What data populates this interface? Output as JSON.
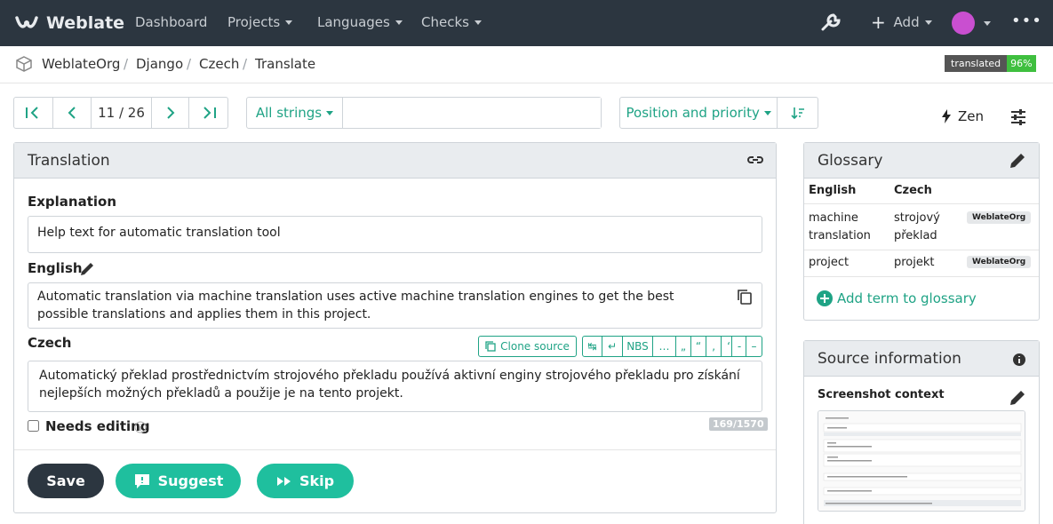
{
  "navbar": {
    "brand": "Weblate",
    "links": {
      "dashboard": "Dashboard",
      "projects": "Projects",
      "languages": "Languages",
      "checks": "Checks"
    },
    "add_label": "Add"
  },
  "breadcrumb": {
    "items": [
      "WeblateOrg",
      "Django",
      "Czech",
      "Translate"
    ],
    "separator": "/",
    "badge_label": "translated",
    "badge_value": "96%"
  },
  "toolbar": {
    "position": "11 / 26",
    "filter": "All strings",
    "search_placeholder": "",
    "sort": "Position and priority",
    "zen": "Zen"
  },
  "translation_panel": {
    "title": "Translation",
    "explanation_label": "Explanation",
    "explanation_text": "Help text for automatic translation tool",
    "source_label": "English",
    "source_text": "Automatic translation via machine translation uses active machine translation engines to get the best possible translations and applies them in this project.",
    "target_label": "Czech",
    "clone_source": "Clone source",
    "special_chars": [
      "↹",
      "↵",
      "NBS",
      "…",
      "„",
      "“",
      "‚",
      "‘",
      "-",
      "–"
    ],
    "target_text": "Automatický překlad prostřednictvím strojového překladu používá aktivní enginy strojového překladu pro získání nejlepších možných překladů a použije je na tento projekt.",
    "needs_editing": "Needs editing",
    "counter": "169/1570",
    "buttons": {
      "save": "Save",
      "suggest": "Suggest",
      "skip": "Skip"
    }
  },
  "glossary": {
    "title": "Glossary",
    "col_source": "English",
    "col_target": "Czech",
    "rows": [
      {
        "source": "machine translation",
        "target": "strojový překlad",
        "tag": "WeblateOrg"
      },
      {
        "source": "project",
        "target": "projekt",
        "tag": "WeblateOrg"
      }
    ],
    "add_term": "Add term to glossary"
  },
  "source_info": {
    "title": "Source information",
    "screenshot_label": "Screenshot context"
  },
  "colors": {
    "navbar": "#2c3640",
    "accent": "#1fa385",
    "button_teal": "#1fbf9e",
    "badge_green": "#3fbf3f"
  }
}
